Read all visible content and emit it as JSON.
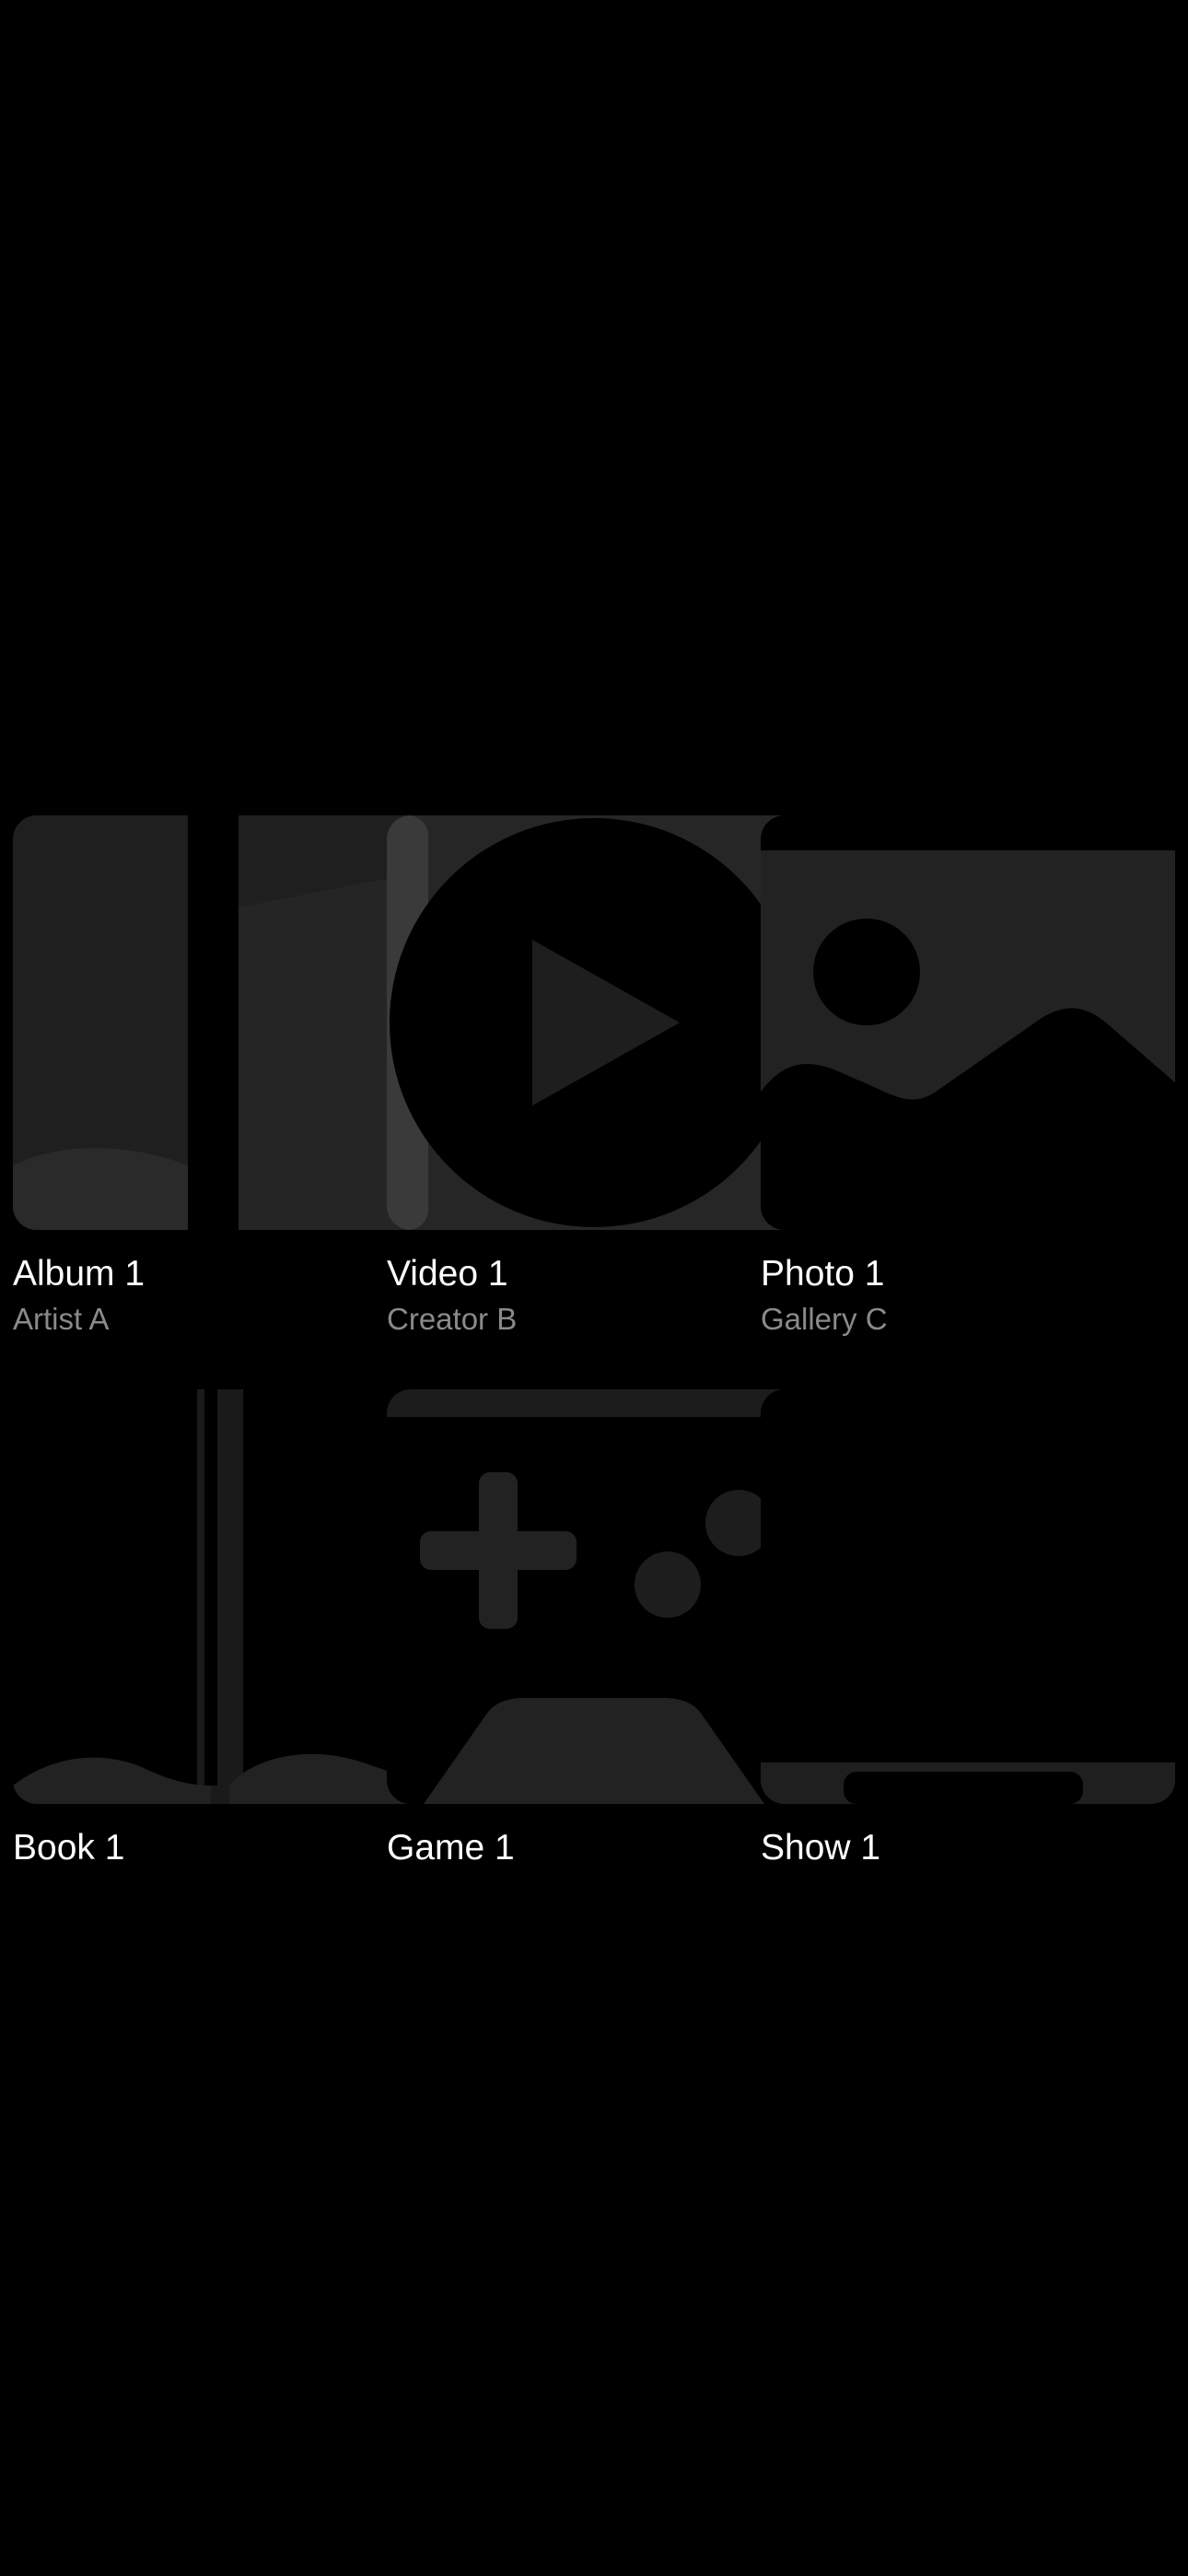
{
  "items": [
    {
      "title": "Album 1",
      "subtitle": "Artist A",
      "icon": "music-note-icon"
    },
    {
      "title": "Video 1",
      "subtitle": "Creator B",
      "icon": "play-circle-icon"
    },
    {
      "title": "Photo 1",
      "subtitle": "Gallery C",
      "icon": "photo-icon"
    },
    {
      "title": "Book 1",
      "subtitle": "",
      "icon": "open-book-icon"
    },
    {
      "title": "Game 1",
      "subtitle": "",
      "icon": "game-controller-icon"
    },
    {
      "title": "Show 1",
      "subtitle": "",
      "icon": "tv-icon"
    }
  ],
  "colors": {
    "background": "#000000",
    "thumbnail": "#1f1f1f",
    "title": "#ffffff",
    "subtitle": "#8a8a8a"
  }
}
